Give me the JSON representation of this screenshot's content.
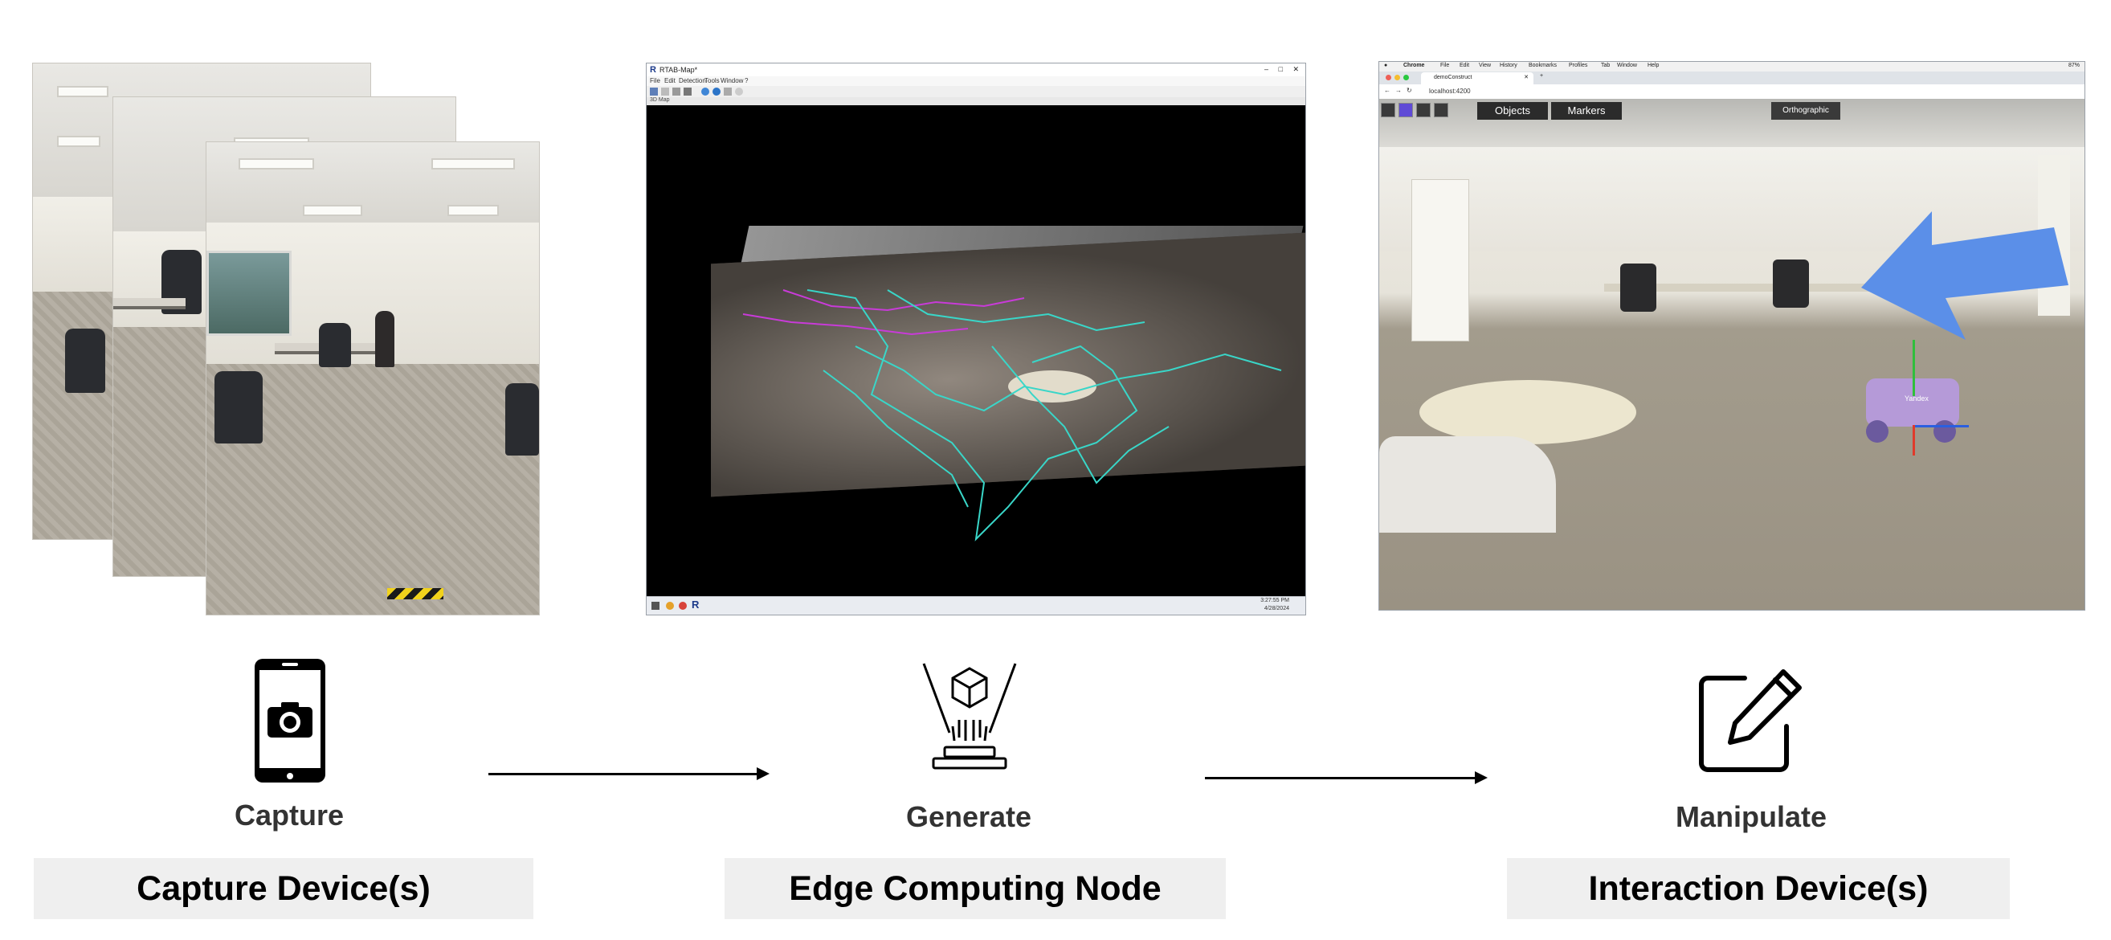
{
  "stages": [
    {
      "label": "Capture",
      "device": "Capture Device(s)",
      "icon": "smartphone-camera-icon"
    },
    {
      "label": "Generate",
      "device": "Edge Computing Node",
      "icon": "hologram-cube-icon"
    },
    {
      "label": "Manipulate",
      "device": "Interaction Device(s)",
      "icon": "edit-square-icon"
    }
  ],
  "edge_window": {
    "title": "RTAB-Map*",
    "menu": [
      "File",
      "Edit",
      "Detection",
      "Tools",
      "Window",
      "?"
    ],
    "panel": "3D Map",
    "clock_time": "3:27:55 PM",
    "clock_date": "4/28/2024"
  },
  "browser": {
    "mac_menu": [
      "Chrome",
      "File",
      "Edit",
      "View",
      "History",
      "Bookmarks",
      "Profiles",
      "Tab",
      "Window",
      "Help"
    ],
    "battery": "87%",
    "tab_title": "demoConstruct",
    "url": "localhost:4200",
    "buttons": [
      "Objects",
      "Markers"
    ],
    "view_mode": "Orthographic",
    "robot_label": "Yandex"
  },
  "colors": {
    "pointer_arrow": "#5b8fe8",
    "trajectory": "#39d6c8",
    "trajectory_alt": "#c83bd8",
    "robot": "#b59ad8"
  }
}
